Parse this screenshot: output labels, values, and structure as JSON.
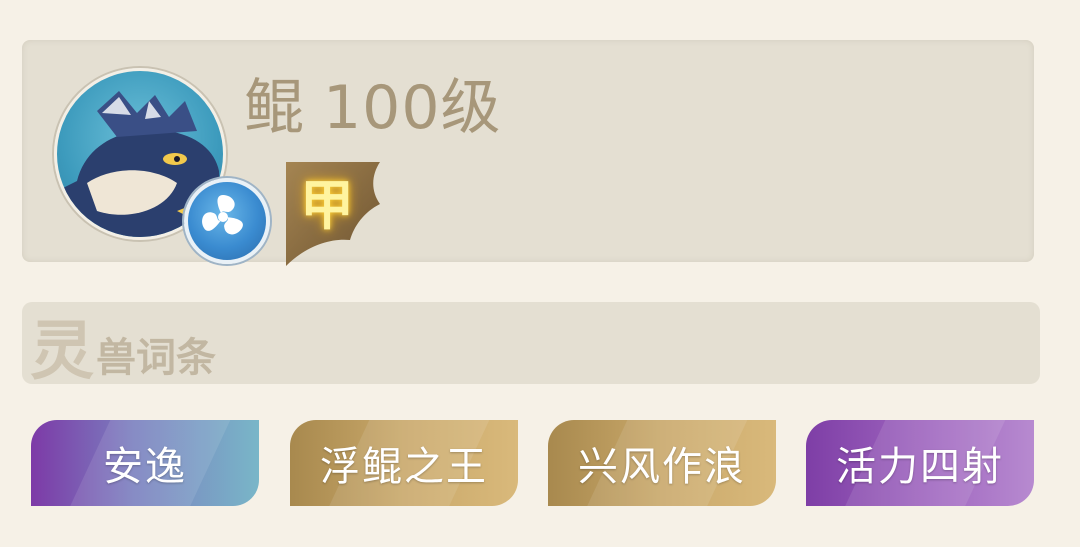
{
  "beast": {
    "name": "鲲",
    "level": "100级",
    "grade": "甲",
    "avatar_icon": "whale-kun-icon",
    "element_icon": "water-swirl-icon"
  },
  "traits_section": {
    "title_big": "灵",
    "title_rest": "兽词条"
  },
  "traits": [
    {
      "label": "安逸",
      "color": "purple-blue"
    },
    {
      "label": "浮鲲之王",
      "color": "gold"
    },
    {
      "label": "兴风作浪",
      "color": "gold"
    },
    {
      "label": "活力四射",
      "color": "purple"
    }
  ],
  "colors": {
    "background": "#f6f1e7",
    "card": "#e4dfd2",
    "name_text": "#a7977a",
    "grade_glow": "#ffd23a",
    "gold_tag": "#c9a86a",
    "purple_tag": "#7e3ea6"
  }
}
